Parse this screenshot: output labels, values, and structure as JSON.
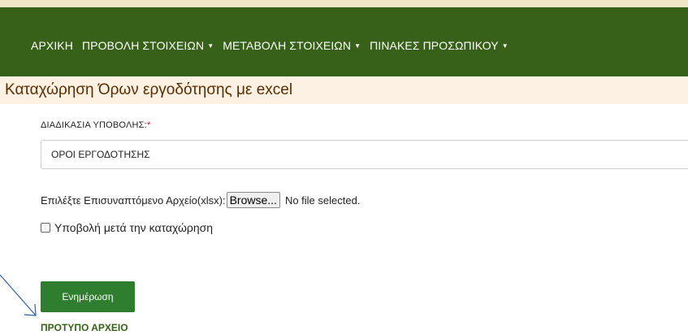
{
  "nav": {
    "items": [
      {
        "label": "ΑΡΧΙΚΗ",
        "dropdown": false
      },
      {
        "label": "ΠΡΟΒΟΛΗ ΣΤΟΙΧΕΙΩΝ",
        "dropdown": true
      },
      {
        "label": "ΜΕΤΑΒΟΛΗ ΣΤΟΙΧΕΙΩΝ",
        "dropdown": true
      },
      {
        "label": "ΠΙΝΑΚΕΣ ΠΡΟΣΩΠΙΚΟΥ",
        "dropdown": true
      }
    ],
    "caret": "▼"
  },
  "page": {
    "title": "Καταχώρηση Όρων εργοδότησης με excel"
  },
  "form": {
    "procedure_label": "ΔΙΑΔΙΚΑΣΙΑ ΥΠΟΒΟΛΗΣ:",
    "required_mark": "*",
    "procedure_value": "ΟΡΟΙ ΕΡΓΟΔΟΤΗΣΗΣ",
    "file_label": "Επιλέξτε Επισυναπτόμενο Αρχείο(xlsx):",
    "browse_label": "Browse...",
    "file_status": "No file selected.",
    "submit_after_label": "Υποβολή μετά την καταχώρηση",
    "submit_after_checked": false,
    "update_button": "Ενημέρωση",
    "template_link": "ΠΡΟΤΥΠΟ ΑΡΧΕΙΟ"
  },
  "colors": {
    "nav_bg": "#376118",
    "title_bg": "#fdf1e4",
    "button_bg": "#2f7d2f",
    "required": "#cc0000"
  }
}
